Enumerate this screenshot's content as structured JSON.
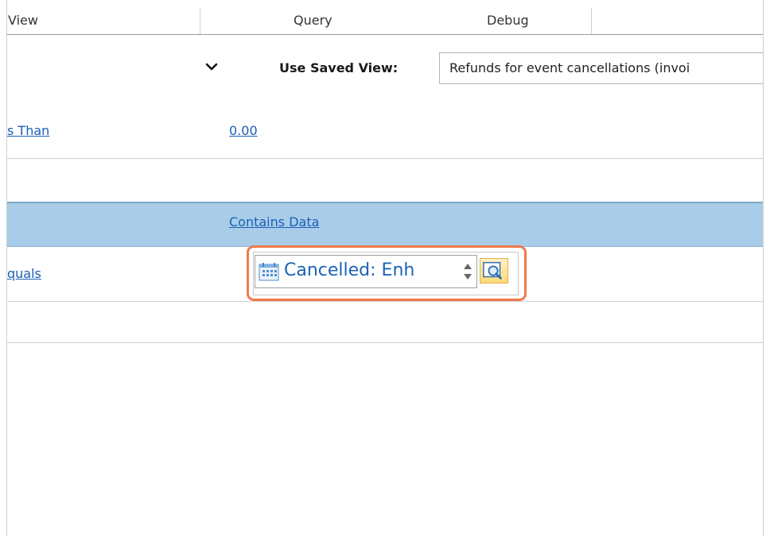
{
  "tabs": {
    "view": "View",
    "query": "Query",
    "debug": "Debug"
  },
  "saved_view": {
    "label": "Use Saved View:",
    "value": "Refunds for event cancellations (invoi"
  },
  "filters": {
    "row1": {
      "operator": "s Than",
      "value": "0.00"
    },
    "header": {
      "operator": "Contains Data"
    },
    "row2": {
      "operator": "quals",
      "lookup_value": "Cancelled: Enh"
    }
  },
  "colors": {
    "header_band": "#a9cde8",
    "link": "#1a5fb4",
    "highlight": "#f07a4a",
    "lookup_text": "#1c63b7"
  },
  "icons": [
    "chevron-down-icon",
    "calendar-icon",
    "spin-arrows-icon",
    "lookup-search-icon"
  ]
}
